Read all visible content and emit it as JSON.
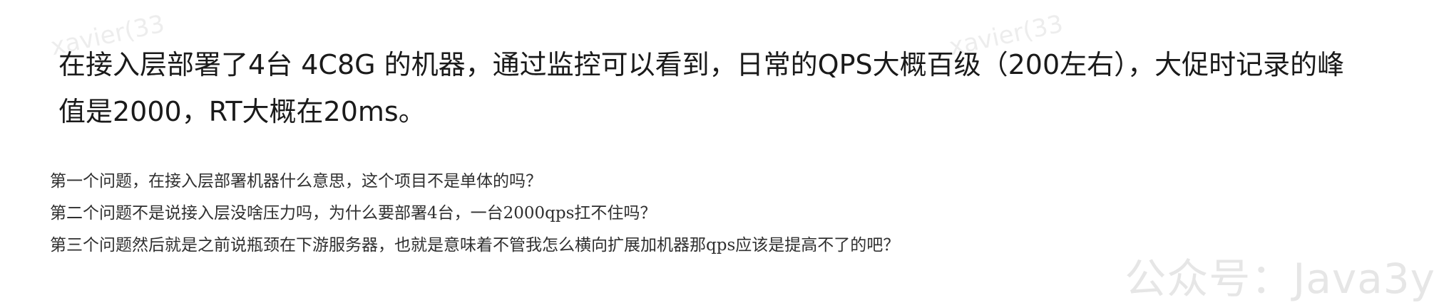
{
  "watermarks": [
    "xavier(33",
    "xavier(33"
  ],
  "quote": {
    "lines": [
      "在接入层部署了4台 4C8G 的机器，通过监控可以看到，日常的QPS大概百级（200左右），大促时记录的峰",
      "值是2000，RT大概在20ms。"
    ]
  },
  "questions": [
    "第一个问题，在接入层部署机器什么意思，这个项目不是单体的吗？",
    "第二个问题不是说接入层没啥压力吗，为什么要部署4台，一台2000qps扛不住吗？",
    "第三个问题然后就是之前说瓶颈在下游服务器，也就是意味着不管我怎么横向扩展加机器那qps应该是提高不了的吧？"
  ],
  "wechat_watermark": "公众号：Java3y"
}
